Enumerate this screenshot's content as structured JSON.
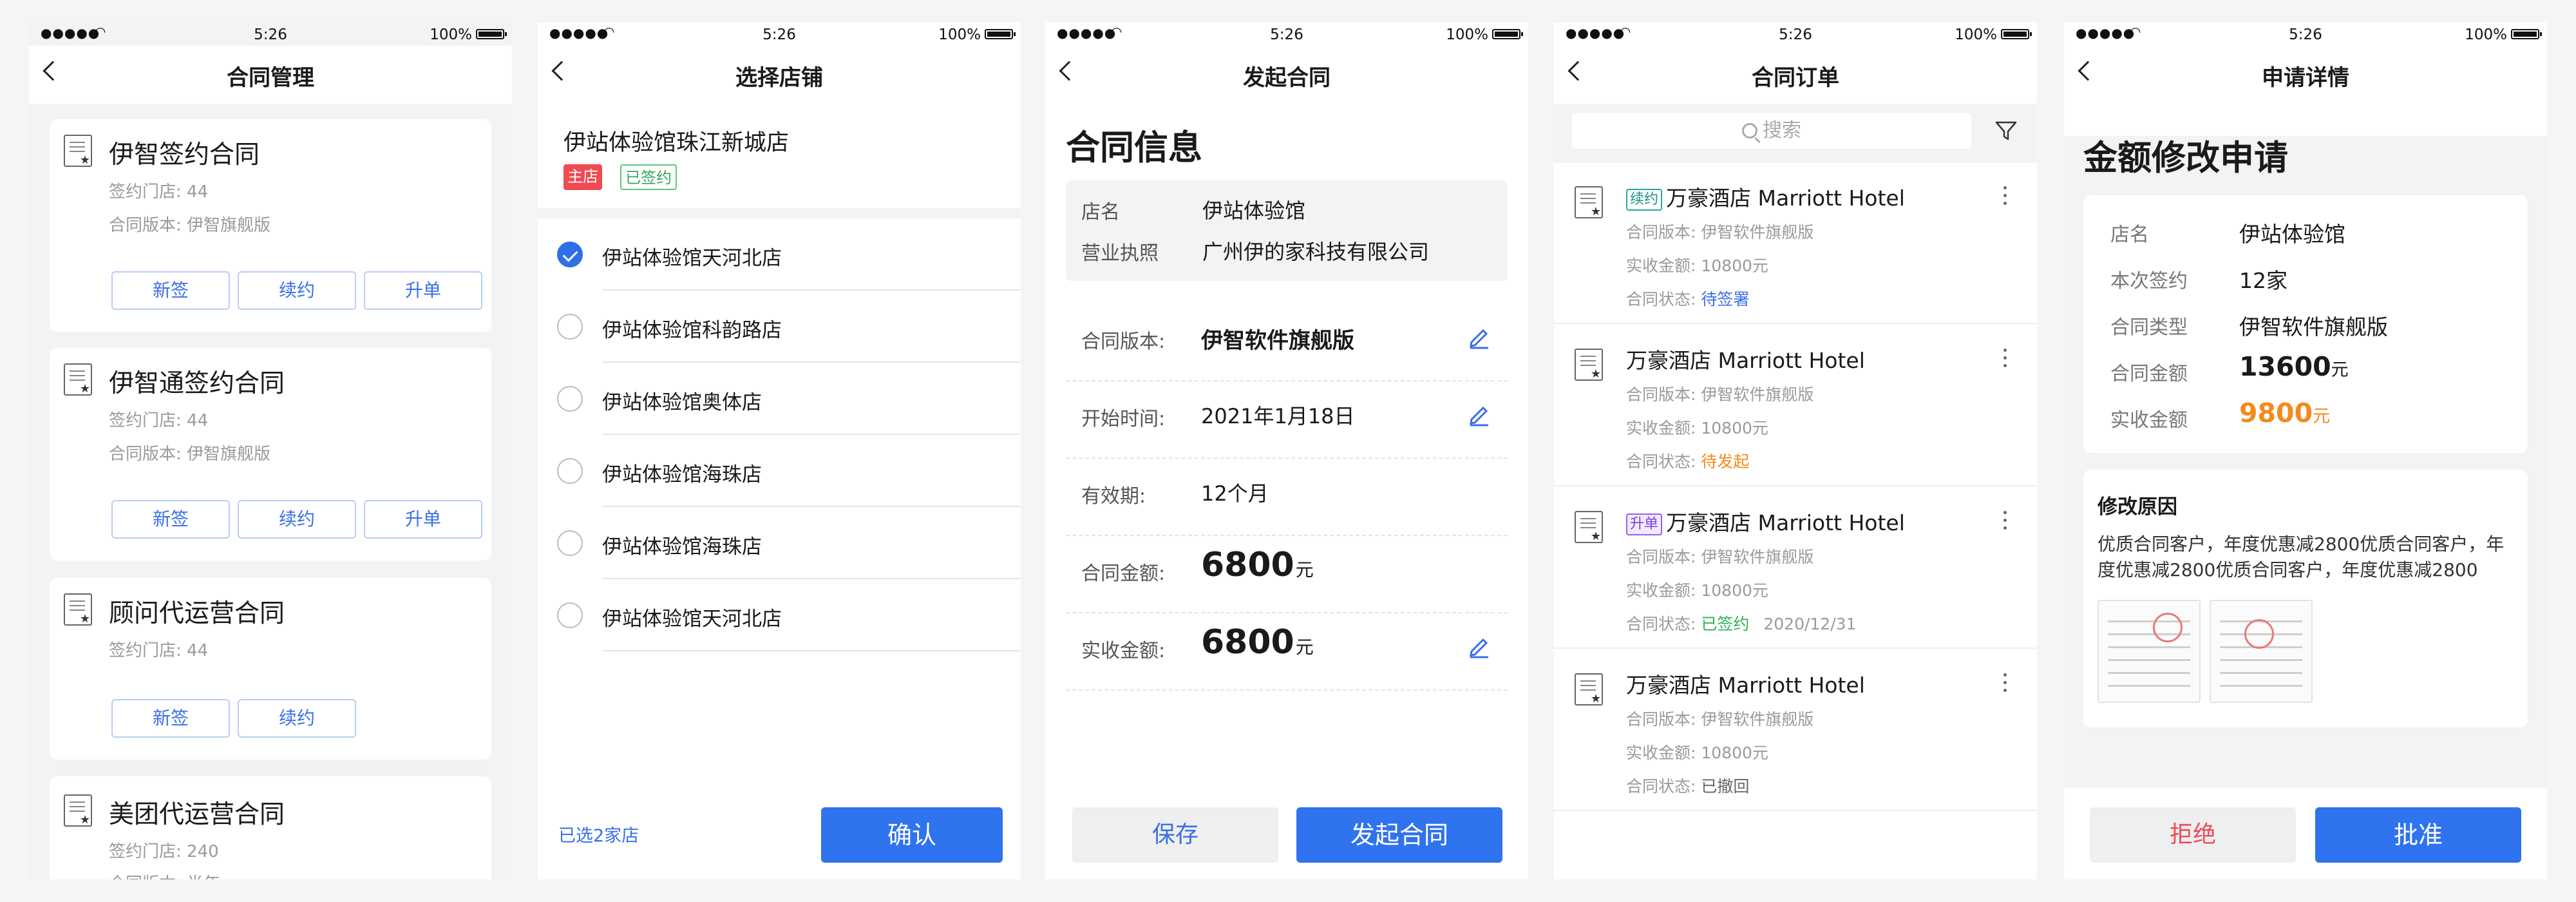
{
  "status": {
    "time": "5:26",
    "battery": "100%"
  },
  "phone1": {
    "title": "合同管理",
    "cards": [
      {
        "name": "伊智签约合同",
        "stores": "签约门店: 44",
        "version": "合同版本: 伊智旗舰版",
        "buttons": [
          "新签",
          "续约",
          "升单"
        ]
      },
      {
        "name": "伊智通签约合同",
        "stores": "签约门店: 44",
        "version": "合同版本: 伊智旗舰版",
        "buttons": [
          "新签",
          "续约",
          "升单"
        ]
      },
      {
        "name": "顾问代运营合同",
        "stores": "签约门店: 44",
        "buttons": [
          "新签",
          "续约"
        ]
      },
      {
        "name": "美团代运营合同",
        "stores": "签约门店: 240",
        "version": "合同版本: 半年"
      }
    ]
  },
  "phone2": {
    "title": "选择店铺",
    "main_store": "伊站体验馆珠江新城店",
    "tags": [
      "主店",
      "已签约"
    ],
    "stores": [
      {
        "name": "伊站体验馆天河北店",
        "checked": true
      },
      {
        "name": "伊站体验馆科韵路店",
        "checked": false
      },
      {
        "name": "伊站体验馆奥体店",
        "checked": false
      },
      {
        "name": "伊站体验馆海珠店",
        "checked": false
      },
      {
        "name": "伊站体验馆海珠店",
        "checked": false
      },
      {
        "name": "伊站体验馆天河北店",
        "checked": false
      }
    ],
    "selected_count": "已选2家店",
    "confirm": "确认"
  },
  "phone3": {
    "title": "发起合同",
    "section_title": "合同信息",
    "store_label": "店名",
    "store_value": "伊站体验馆",
    "license_label": "营业执照",
    "license_value": "广州伊的家科技有限公司",
    "rows": [
      {
        "label": "合同版本:",
        "value": "伊智软件旗舰版"
      },
      {
        "label": "开始时间:",
        "value": "2021年1月18日"
      },
      {
        "label": "有效期:",
        "value": "12个月"
      }
    ],
    "amount_label": "合同金额:",
    "amount_value": "6800",
    "received_label": "实收金额:",
    "received_value": "6800",
    "unit": "元",
    "save": "保存",
    "submit": "发起合同"
  },
  "phone4": {
    "title": "合同订单",
    "search_placeholder": "搜索",
    "orders": [
      {
        "tag": "续约",
        "name": "万豪酒店 Marriott Hotel",
        "version": "合同版本: 伊智软件旗舰版",
        "received": "实收金额: 10800元",
        "status_label": "合同状态:",
        "status": "待签署",
        "date": ""
      },
      {
        "tag": "",
        "name": "万豪酒店 Marriott Hotel",
        "version": "合同版本: 伊智软件旗舰版",
        "received": "实收金额: 10800元",
        "status_label": "合同状态:",
        "status": "待发起",
        "date": ""
      },
      {
        "tag": "升单",
        "name": "万豪酒店 Marriott Hotel",
        "version": "合同版本: 伊智软件旗舰版",
        "received": "实收金额: 10800元",
        "status_label": "合同状态:",
        "status": "已签约",
        "date": "2020/12/31"
      },
      {
        "tag": "",
        "name": "万豪酒店 Marriott Hotel",
        "version": "合同版本: 伊智软件旗舰版",
        "received": "实收金额: 10800元",
        "status_label": "合同状态:",
        "status": "已撤回",
        "date": ""
      }
    ],
    "colors": {
      "blue": "#3a6fe6",
      "orange": "#f28b1e",
      "green": "#2fb352"
    }
  },
  "phone5": {
    "title": "申请详情",
    "heading": "金额修改申请",
    "details": [
      {
        "label": "店名",
        "value": "伊站体验馆"
      },
      {
        "label": "本次签约",
        "value": "12家"
      },
      {
        "label": "合同类型",
        "value": "伊智软件旗舰版"
      }
    ],
    "amount_label": "合同金额",
    "amount_value": "13600",
    "received_label": "实收金额",
    "received_value": "9800",
    "unit": "元",
    "reason_title": "修改原因",
    "reason_line1": "优质合同客户，年度优惠减2800优质合同客户，年",
    "reason_line2": "度优惠减2800优质合同客户，年度优惠减2800",
    "reject": "拒绝",
    "approve": "批准"
  }
}
